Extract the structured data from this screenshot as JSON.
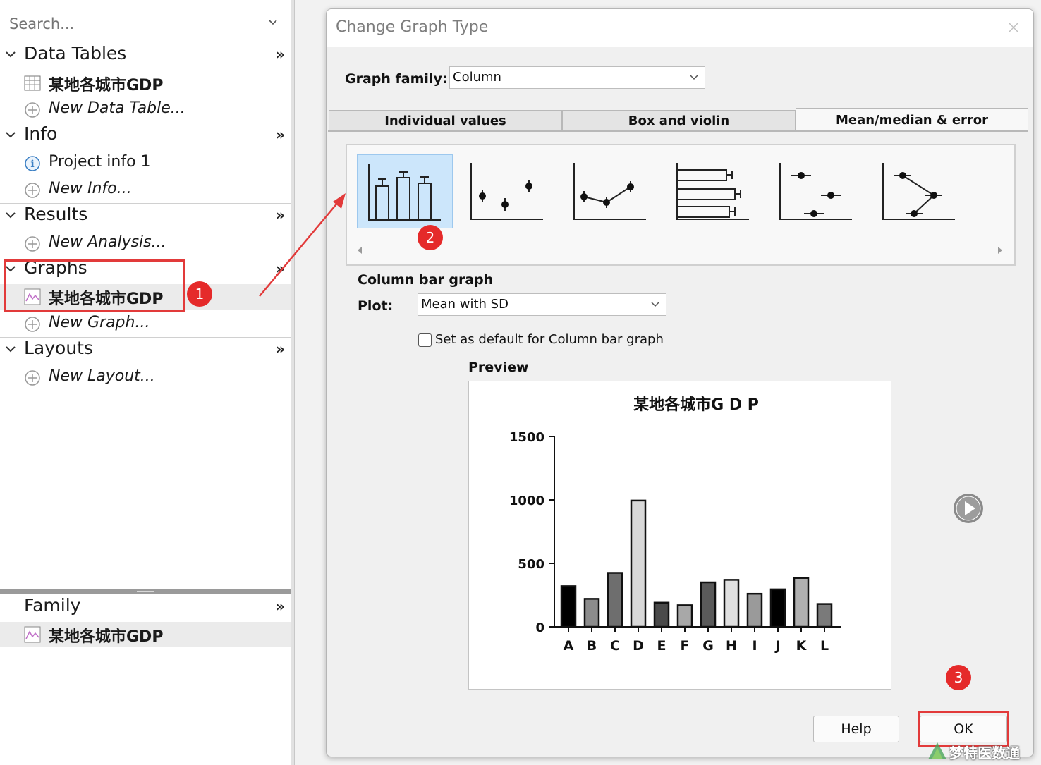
{
  "navigator": {
    "search_placeholder": "Search...",
    "sections": {
      "data_tables": {
        "label": "Data Tables",
        "more": "»"
      },
      "info": {
        "label": "Info",
        "more": "»"
      },
      "results": {
        "label": "Results",
        "more": "»"
      },
      "graphs": {
        "label": "Graphs",
        "more": "»"
      },
      "layouts": {
        "label": "Layouts",
        "more": "»"
      }
    },
    "items": {
      "data_table_1": "某地各城市GDP",
      "new_data_table": "New Data Table...",
      "project_info": "Project info 1",
      "new_info": "New Info...",
      "new_analysis": "New Analysis...",
      "graph_1": "某地各城市GDP",
      "new_graph": "New Graph...",
      "new_layout": "New Layout..."
    },
    "family": {
      "label": "Family",
      "more": "»",
      "item": "某地各城市GDP"
    }
  },
  "dialog": {
    "title": "Change Graph Type",
    "graph_family_label": "Graph family:",
    "graph_family_value": "Column",
    "tabs": [
      "Individual values",
      "Box and violin",
      "Mean/median & error"
    ],
    "active_tab": 2,
    "selected_type_label": "Column bar graph",
    "plot_label": "Plot:",
    "plot_value": "Mean with SD",
    "default_checkbox_label": "Set as default for Column bar graph",
    "default_checkbox_checked": false,
    "preview_label": "Preview",
    "help_button": "Help",
    "ok_button": "OK"
  },
  "annotations": {
    "badge_1": "1",
    "badge_2": "2",
    "badge_3": "3"
  },
  "watermark": "梦特医数通",
  "colors": {
    "annotation_red": "#e23a3a",
    "badge_red": "#e52a2a",
    "selection_blue": "#cce6fb"
  },
  "chart_data": {
    "type": "bar",
    "title": "某地各城市G D P",
    "categories": [
      "A",
      "B",
      "C",
      "D",
      "E",
      "F",
      "G",
      "H",
      "I",
      "J",
      "K",
      "L"
    ],
    "values": [
      320,
      220,
      425,
      995,
      190,
      170,
      350,
      370,
      260,
      295,
      385,
      180
    ],
    "bar_colors": [
      "#000000",
      "#8c8c8c",
      "#6e6e6e",
      "#d8d8d8",
      "#4a4a4a",
      "#a8a8a8",
      "#5a5a5a",
      "#e0e0e0",
      "#9a9a9a",
      "#000000",
      "#b0b0b0",
      "#7a7a7a"
    ],
    "ylim": [
      0,
      1500
    ],
    "yticks": [
      0,
      500,
      1000,
      1500
    ],
    "xlabel": "",
    "ylabel": "",
    "grid": false
  }
}
